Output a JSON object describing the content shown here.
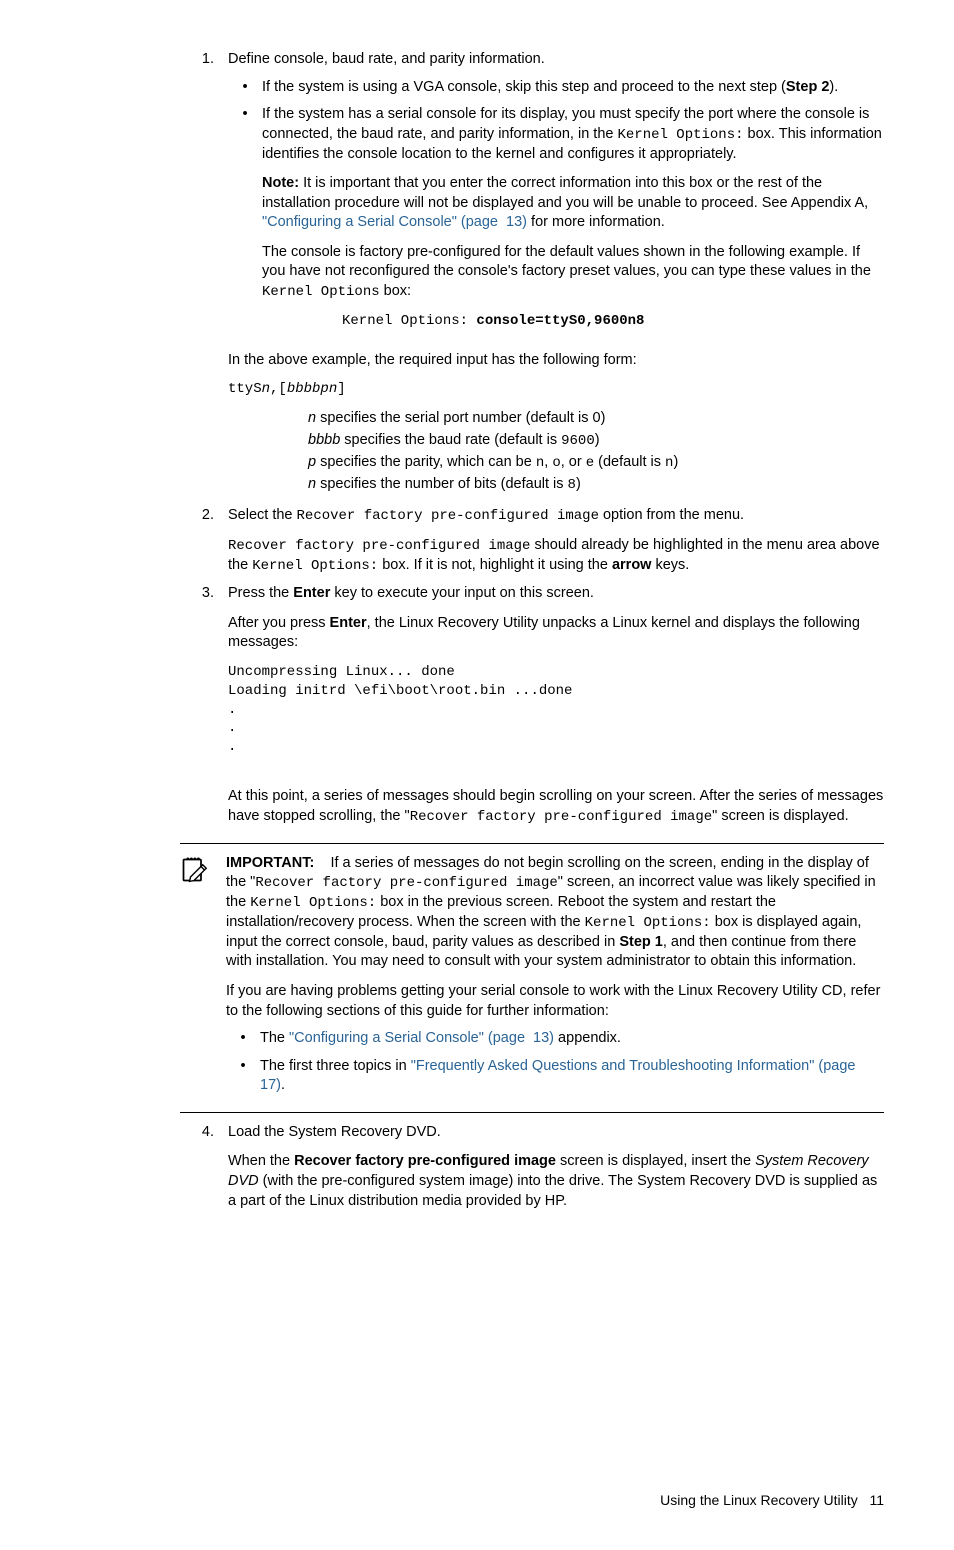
{
  "steps": {
    "s1": {
      "num": "1.",
      "lead": "Define console, baud rate, and parity information.",
      "bullet1": {
        "pre": "If the system is using a VGA console, skip this step and proceed to the next step (",
        "bold": "Step 2",
        "post": ")."
      },
      "bullet2": {
        "p1a": "If the system has a serial console for its display, you must specify the port where the console is connected, the baud rate, and parity information, in the ",
        "p1code": "Kernel Options:",
        "p1b": " box. This information identifies the console location to the kernel and configures it appropriately.",
        "note_bold": "Note:",
        "note_text_a": " It is important that you enter the correct information into this box or the rest of the installation procedure will not be displayed and you will be unable to proceed. See Appendix A, ",
        "note_link": "\"Configuring a Serial Console\" (page  13)",
        "note_text_b": " for more information.",
        "p3a": "The console is factory pre-configured for the default values shown in the following example. If you have not reconfigured the console's factory preset values, you can type these values in the ",
        "p3code": "Kernel Options",
        "p3b": " box:",
        "code_label": "Kernel Options: ",
        "code_bold": "console=ttyS0,9600n8"
      },
      "after_example": "In the above example, the required input has the following form:",
      "form_pre": "ttyS",
      "form_it1": "n",
      "form_mid": ",[",
      "form_it2": "bbbbpn",
      "form_post": "]",
      "def1_it": "n",
      "def1_txt": " specifies the serial port number (default is 0)",
      "def2_it": "bbbb",
      "def2_txt_a": " specifies the baud rate (default is ",
      "def2_code": "9600",
      "def2_txt_b": ")",
      "def3_it": "p",
      "def3_txt_a": " specifies the parity, which can be ",
      "def3_c1": "n",
      "def3_m1": ", ",
      "def3_c2": "o",
      "def3_m2": ", or ",
      "def3_c3": "e",
      "def3_m3": " (default is ",
      "def3_c4": "n",
      "def3_m4": ")",
      "def4_it": "n",
      "def4_txt_a": " specifies the number of bits (default is ",
      "def4_code": "8",
      "def4_txt_b": ")"
    },
    "s2": {
      "num": "2.",
      "lead_a": "Select the ",
      "lead_code": "Recover factory pre-configured image",
      "lead_b": " option from the menu.",
      "p_code1": "Recover factory pre-configured image",
      "p_a": " should already be highlighted in the menu area above the ",
      "p_code2": "Kernel Options:",
      "p_b": " box. If it is not, highlight it using the ",
      "p_bold": "arrow",
      "p_c": " keys."
    },
    "s3": {
      "num": "3.",
      "lead_a": "Press the ",
      "lead_bold": "Enter",
      "lead_b": " key to execute your input on this screen.",
      "p1_a": "After you press ",
      "p1_bold": "Enter",
      "p1_b": ", the Linux Recovery Utility unpacks a Linux kernel and displays the following messages:",
      "code": "Uncompressing Linux... done\nLoading initrd \\efi\\boot\\root.bin ...done\n.\n.\n.",
      "p2_a": "At this point, a series of messages should begin scrolling on your screen. After the series of messages have stopped scrolling, the \"",
      "p2_code": "Recover factory pre-configured image",
      "p2_b": "\" screen is displayed."
    },
    "s4": {
      "num": "4.",
      "lead": "Load the System Recovery DVD.",
      "p_a": "When the ",
      "p_bold": "Recover factory pre-configured image",
      "p_b": " screen is displayed, insert the ",
      "p_it": "System Recovery DVD",
      "p_c": " (with the pre-configured system image) into the drive. The System Recovery DVD is supplied as a part of the Linux distribution media provided by HP."
    }
  },
  "callout": {
    "label": "IMPORTANT:",
    "p1_a": "If a series of messages do not begin scrolling on the screen, ending in the display of the \"",
    "p1_code1": "Recover factory pre-configured image",
    "p1_b": "\" screen, an incorrect value was likely specified in the ",
    "p1_code2": "Kernel Options:",
    "p1_c": " box in the previous screen. Reboot the system and restart the installation/recovery process. When the screen with the ",
    "p1_code3": "Kernel Options:",
    "p1_d": " box is displayed again, input the correct console, baud, parity values as described in ",
    "p1_bold": "Step 1",
    "p1_e": ", and then continue from there with installation. You may need to consult with your system administrator to obtain this information.",
    "p2": "If you are having problems getting your serial console to work with the Linux Recovery Utility CD, refer to the following sections of this guide for further information:",
    "b1_a": "The ",
    "b1_link": "\"Configuring a Serial Console\" (page  13)",
    "b1_b": " appendix.",
    "b2_a": "The first three topics in ",
    "b2_link": "\"Frequently Asked Questions and Troubleshooting Information\" (page  17)",
    "b2_b": "."
  },
  "footer": {
    "section": "Using the Linux Recovery Utility",
    "page": "11"
  }
}
